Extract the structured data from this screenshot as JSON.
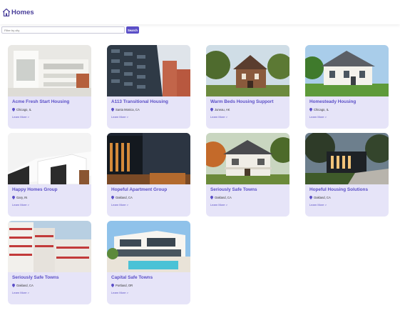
{
  "header": {
    "brand": "Homes",
    "logo_icon": "house-icon"
  },
  "search": {
    "placeholder": "Filter by city",
    "button_label": "Search"
  },
  "cards": [
    {
      "title": "Acme Fresh Start Housing",
      "location": "Chicago, IL",
      "link": "Learn More >",
      "photo": "modern-white-apartment"
    },
    {
      "title": "A113 Transitional Housing",
      "location": "Santa Monica, CA",
      "link": "Learn More >",
      "photo": "dark-apartment-tower"
    },
    {
      "title": "Warm Beds Housing Support",
      "location": "Juneau, AK",
      "link": "Learn More >",
      "photo": "victorian-house"
    },
    {
      "title": "Homesteady Housing",
      "location": "Chicago, IL",
      "link": "Learn More >",
      "photo": "white-colonial-house"
    },
    {
      "title": "Happy Homes Group",
      "location": "Gary, IN",
      "link": "Learn More >",
      "photo": "white-modern-house"
    },
    {
      "title": "Hopeful Apartment Group",
      "location": "Oakland, CA",
      "link": "Learn More >",
      "photo": "night-apartment-building"
    },
    {
      "title": "Seriously Safe Towns",
      "location": "Oakland, CA",
      "link": "Learn More >",
      "photo": "autumn-craftsman-house"
    },
    {
      "title": "Hopeful Housing Solutions",
      "location": "Oakland, CA",
      "link": "Learn More >",
      "photo": "modern-house-dusk"
    },
    {
      "title": "Seriously Safe Towns",
      "location": "Oakland, CA",
      "link": "Learn More >",
      "photo": "red-white-towers"
    },
    {
      "title": "Capital Safe Towns",
      "location": "Portland, OR",
      "link": "Learn More >",
      "photo": "villa-with-pool"
    }
  ]
}
